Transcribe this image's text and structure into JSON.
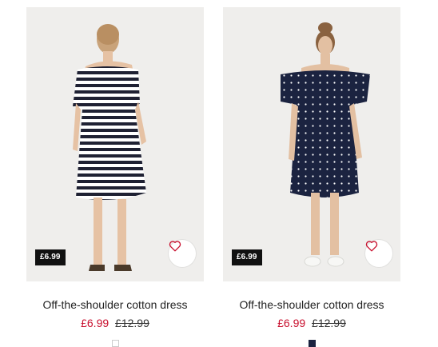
{
  "products": [
    {
      "name": "Off-the-shoulder cotton dress",
      "tag_price": "£6.99",
      "price": "£6.99",
      "old_price": "£12.99",
      "image": "striped-off-shoulder-dress-photo",
      "swatch_color": "#ffffff",
      "swatch_border": "#cccccc"
    },
    {
      "name": "Off-the-shoulder cotton dress",
      "tag_price": "£6.99",
      "price": "£6.99",
      "old_price": "£12.99",
      "image": "navy-polka-dot-off-shoulder-dress-photo",
      "swatch_color": "#1b2340",
      "swatch_border": "#1b2340"
    }
  ],
  "colors": {
    "sale_price": "#c8102e",
    "favourite_icon": "#c8102e",
    "price_tag_bg": "#111111",
    "image_bg": "#efeeec"
  },
  "icons": {
    "favourite": "heart-outline-icon"
  }
}
